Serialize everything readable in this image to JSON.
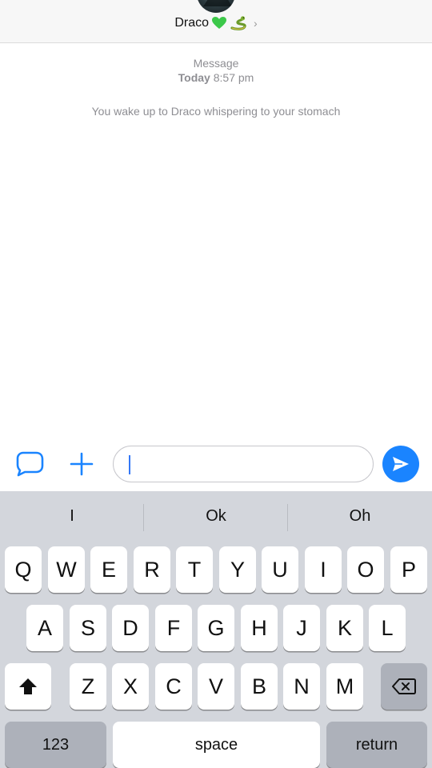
{
  "header": {
    "contact_name": "Draco",
    "chevron": "›",
    "heart_color": "#3cc84a",
    "snake_color": "#6a9a2a"
  },
  "conversation": {
    "label": "Message",
    "day": "Today",
    "time": "8:57 pm",
    "system_message": "You wake up to Draco whispering to your stomach"
  },
  "input_bar": {
    "left_icon": "message-bubble-icon",
    "add_icon": "plus-icon",
    "send_icon": "send-arrow-icon",
    "field_value": "",
    "accent": "#1a84ff"
  },
  "keyboard": {
    "suggestions": [
      "I",
      "Ok",
      "Oh"
    ],
    "row1": [
      "Q",
      "W",
      "E",
      "R",
      "T",
      "Y",
      "U",
      "I",
      "O",
      "P"
    ],
    "row2": [
      "A",
      "S",
      "D",
      "F",
      "G",
      "H",
      "J",
      "K",
      "L"
    ],
    "row3": [
      "Z",
      "X",
      "C",
      "V",
      "B",
      "N",
      "M"
    ],
    "numbers_label": "123",
    "space_label": "space",
    "return_label": "return",
    "shift_icon": "shift-icon",
    "delete_icon": "backspace-icon"
  }
}
